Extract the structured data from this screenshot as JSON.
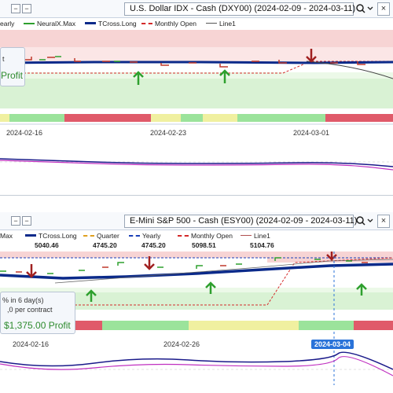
{
  "top": {
    "title": "U.S. Dollar IDX - Cash (DXY00) (2024-02-09 - 2024-03-11)",
    "legend": [
      {
        "label": "early",
        "color": "#1a3fb8"
      },
      {
        "label": "NeuralX.Max",
        "color": "#2ea02e"
      },
      {
        "label": "TCross.Long",
        "color": "#0b2a8a"
      },
      {
        "label": "Monthly Open",
        "color": "#d42a2a"
      },
      {
        "label": "Line1",
        "color": "#555555"
      }
    ],
    "info_line1": "t",
    "info_profit": "Profit",
    "dates": [
      "2024-02-16",
      "2024-02-23",
      "2024-03-01"
    ]
  },
  "bottom": {
    "title": "E-Mini S&P 500 - Cash (ESY00) (2024-02-09 - 2024-03-11)",
    "legend": [
      {
        "label": "Max",
        "value": "",
        "color": "#2ea02e"
      },
      {
        "label": "TCross.Long",
        "value": "5040.46",
        "color": "#0b2a8a"
      },
      {
        "label": "Quarter",
        "value": "4745.20",
        "color": "#e0a020"
      },
      {
        "label": "Yearly",
        "value": "4745.20",
        "color": "#1a3fb8"
      },
      {
        "label": "Monthly Open",
        "value": "5098.51",
        "color": "#d42a2a"
      },
      {
        "label": "Line1",
        "value": "5104.76",
        "color": "#b05050"
      }
    ],
    "info_line1": "% in 6 day(s)",
    "info_line2": ",0 per contract",
    "info_profit": "$1,375.00 Profit",
    "dates": [
      "2024-02-16",
      "2024-02-26"
    ],
    "highlight_date": "2024-03-04"
  },
  "icons": {
    "search": "search-icon",
    "dropdown": "chevron-down-icon",
    "close": "close-icon"
  }
}
